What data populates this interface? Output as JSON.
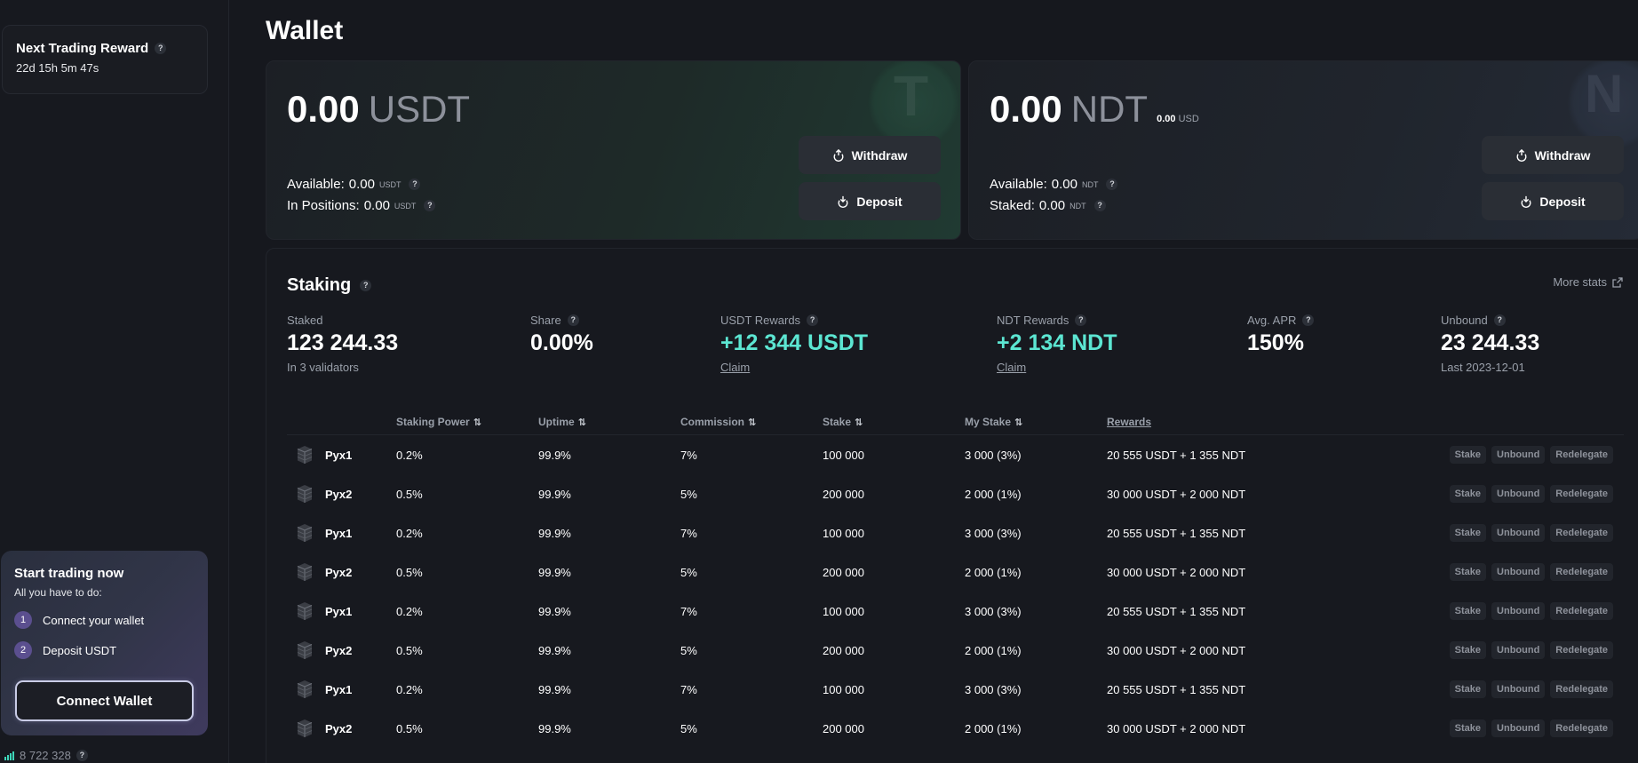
{
  "sidebar": {
    "reward": {
      "title": "Next Trading Reward",
      "timer": "22d 15h 5m 47s"
    },
    "promo": {
      "title": "Start trading now",
      "subtitle": "All you have to do:",
      "steps": [
        {
          "num": "1",
          "label": "Connect your wallet"
        },
        {
          "num": "2",
          "label": "Deposit USDT"
        }
      ],
      "button": "Connect Wallet"
    },
    "network_stat": "8 722 328"
  },
  "page": {
    "title": "Wallet"
  },
  "usdt_card": {
    "amount": "0.00",
    "currency": "USDT",
    "watermark": "T",
    "available_label": "Available:",
    "available_value": "0.00",
    "available_unit": "USDT",
    "positions_label": "In Positions:",
    "positions_value": "0.00",
    "positions_unit": "USDT",
    "withdraw": "Withdraw",
    "deposit": "Deposit"
  },
  "ndt_card": {
    "amount": "0.00",
    "currency": "NDT",
    "usd_value": "0.00",
    "usd_unit": "USD",
    "watermark": "N",
    "available_label": "Available:",
    "available_value": "0.00",
    "available_unit": "NDT",
    "staked_label": "Staked:",
    "staked_value": "0.00",
    "staked_unit": "NDT",
    "withdraw": "Withdraw",
    "deposit": "Deposit"
  },
  "staking": {
    "title": "Staking",
    "more_stats": "More stats",
    "stats": {
      "staked": {
        "label": "Staked",
        "value": "123 244.33",
        "sub": "In 3 validators"
      },
      "share": {
        "label": "Share",
        "value": "0.00%"
      },
      "usdt_rewards": {
        "label": "USDT Rewards",
        "value": "+12 344 USDT",
        "sub": "Claim"
      },
      "ndt_rewards": {
        "label": "NDT Rewards",
        "value": "+2 134 NDT",
        "sub": "Claim"
      },
      "apr": {
        "label": "Avg. APR",
        "value": "150%"
      },
      "unbound": {
        "label": "Unbound",
        "value": "23 244.33",
        "sub": "Last 2023-12-01"
      }
    },
    "columns": [
      "Staking Power",
      "Uptime",
      "Commission",
      "Stake",
      "My Stake",
      "Rewards"
    ],
    "actions": [
      "Stake",
      "Unbound",
      "Redelegate"
    ],
    "rows": [
      {
        "name": "Pyx1",
        "power": "0.2%",
        "uptime": "99.9%",
        "commission": "7%",
        "stake": "100 000",
        "my_stake": "3 000 (3%)",
        "rewards": "20 555 USDT + 1 355 NDT"
      },
      {
        "name": "Pyx2",
        "power": "0.5%",
        "uptime": "99.9%",
        "commission": "5%",
        "stake": "200 000",
        "my_stake": "2 000 (1%)",
        "rewards": "30 000 USDT + 2 000 NDT"
      },
      {
        "name": "Pyx1",
        "power": "0.2%",
        "uptime": "99.9%",
        "commission": "7%",
        "stake": "100 000",
        "my_stake": "3 000 (3%)",
        "rewards": "20 555 USDT + 1 355 NDT"
      },
      {
        "name": "Pyx2",
        "power": "0.5%",
        "uptime": "99.9%",
        "commission": "5%",
        "stake": "200 000",
        "my_stake": "2 000 (1%)",
        "rewards": "30 000 USDT + 2 000 NDT"
      },
      {
        "name": "Pyx1",
        "power": "0.2%",
        "uptime": "99.9%",
        "commission": "7%",
        "stake": "100 000",
        "my_stake": "3 000 (3%)",
        "rewards": "20 555 USDT + 1 355 NDT"
      },
      {
        "name": "Pyx2",
        "power": "0.5%",
        "uptime": "99.9%",
        "commission": "5%",
        "stake": "200 000",
        "my_stake": "2 000 (1%)",
        "rewards": "30 000 USDT + 2 000 NDT"
      },
      {
        "name": "Pyx1",
        "power": "0.2%",
        "uptime": "99.9%",
        "commission": "7%",
        "stake": "100 000",
        "my_stake": "3 000 (3%)",
        "rewards": "20 555 USDT + 1 355 NDT"
      },
      {
        "name": "Pyx2",
        "power": "0.5%",
        "uptime": "99.9%",
        "commission": "5%",
        "stake": "200 000",
        "my_stake": "2 000 (1%)",
        "rewards": "30 000 USDT + 2 000 NDT"
      }
    ]
  },
  "colors": {
    "accent_teal": "#5ce6d2",
    "background": "#16181e",
    "card": "#1c1f25",
    "button": "#2a2e35",
    "step_badge": "#5b4f8f"
  }
}
